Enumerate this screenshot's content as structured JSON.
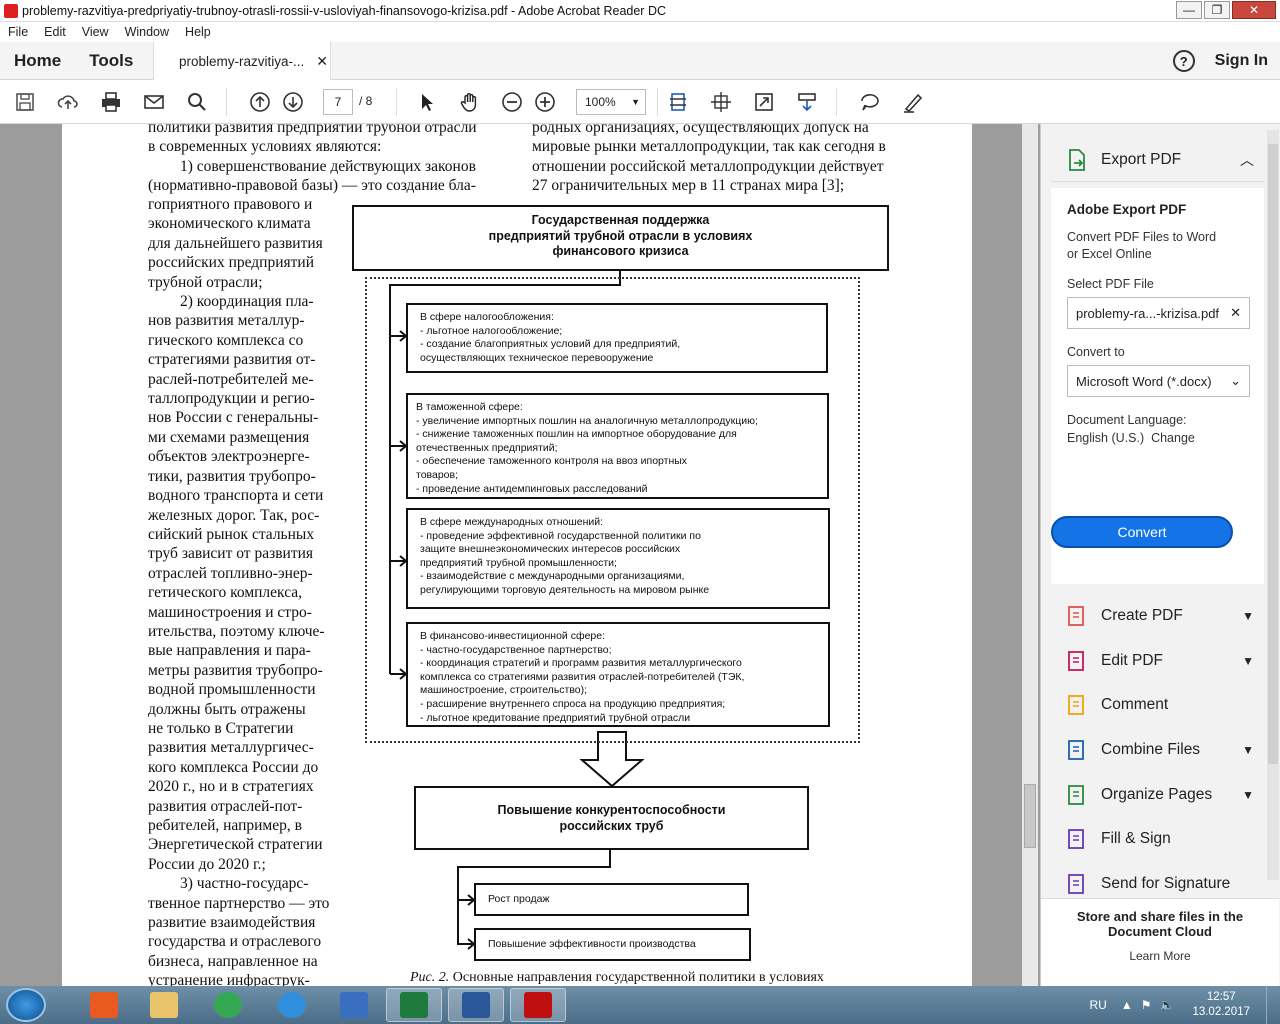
{
  "window": {
    "title": "problemy-razvitiya-predpriyatiy-trubnoy-otrasli-rossii-v-usloviyah-finansovogo-krizisa.pdf - Adobe Acrobat Reader DC"
  },
  "menu": [
    "File",
    "Edit",
    "View",
    "Window",
    "Help"
  ],
  "tabs": {
    "home": "Home",
    "tools": "Tools",
    "doc": "problemy-razvitiya-...",
    "signin": "Sign In"
  },
  "toolbar": {
    "page_current": "7",
    "page_total": "/ 8",
    "zoom": "100%"
  },
  "document": {
    "top_left": [
      "политики развития предприятий трубной отрасли",
      "в современных условиях являются:",
      "1) совершенствование действующих законов",
      "(нормативно-правовой базы) — это создание бла-"
    ],
    "top_right": [
      "родных организациях, осуществляющих допуск на",
      "мировые рынки металлопродукции, так как сегодня в",
      "отношении российской металлопродукции действует",
      "27 ограничительных мер в 11 странах мира [3];"
    ],
    "left_column": [
      "гоприятного правового и",
      "экономического климата",
      "для дальнейшего развития",
      "российских предприятий",
      "трубной отрасли;",
      "2) координация пла-",
      "нов развития металлур-",
      "гического комплекса со",
      "стратегиями развития от-",
      "раслей-потребителей ме-",
      "таллопродукции и регио-",
      "нов России с генеральны-",
      "ми схемами размещения",
      "объектов электроэнерге-",
      "тики, развития трубопро-",
      "водного транспорта и сети",
      "железных дорог. Так, рос-",
      "сийский рынок стальных",
      "труб зависит от развития",
      "отраслей топливно-энер-",
      "гетического комплекса,",
      "машиностроения и стро-",
      "ительства, поэтому ключе-",
      "вые направления и пара-",
      "метры развития трубопро-",
      "водной промышленности",
      "должны быть отражены",
      "не только в Стратегии",
      "развития металлургичес-",
      "кого комплекса России до",
      "2020 г., но и в стратегиях",
      "развития отраслей-пот-",
      "ребителей, например, в",
      "Энергетической стратегии",
      "России до 2020 г.;",
      "3) частно-государс-",
      "твенное партнерство — это",
      "развитие взаимодействия",
      "государства и отраслевого",
      "бизнеса, направленное на",
      "устранение инфраструк-"
    ],
    "diagram": {
      "title": [
        "Государственная поддержка",
        "предприятий трубной отрасли в условиях",
        "финансового кризиса"
      ],
      "box1": [
        "В сфере налогообложения:",
        "- льготное налогообложение;",
        "- создание благоприятных условий для предприятий,",
        "осуществляющих техническое перевооружение"
      ],
      "box2": [
        "В таможенной сфере:",
        "- увеличение импортных пошлин на аналогичную металлопродукцию;",
        "- снижение таможенных пошлин на импортное оборудование для",
        "отечественных предприятий;",
        "- обеспечение таможенного контроля на ввоз ипортных",
        "товаров;",
        "- проведение антидемпинговых расследований"
      ],
      "box3": [
        "В сфере международных отношений:",
        "- проведение эффективной государственной политики по",
        "защите внешнеэкономических интересов российских",
        "предприятий трубной промышленности;",
        "- взаимодействие с международными организациями,",
        "регулирующими торговую деятельность на мировом рынке"
      ],
      "box4": [
        "В финансово-инвестиционной сфере:",
        "- частно-государственное партнерство;",
        "- координация стратегий и программ развития металлургического",
        "комплекса со стратегиями развития отраслей-потребителей (ТЭК,",
        "машиностроение, строительство);",
        "- расширение внутреннего спроса на продукцию предприятия;",
        "- льготное кредитование предприятий трубной отрасли"
      ],
      "result": [
        "Повышение конкурентоспособности",
        "российских труб"
      ],
      "out1": "Рост продаж",
      "out2": "Повышение эффективности производства"
    },
    "caption_label": "Рис. 2.",
    "caption_text": " Основные направления государственной политики в условиях"
  },
  "panel": {
    "export_title": "Export PDF",
    "card_title": "Adobe Export PDF",
    "desc": [
      "Convert PDF Files to Word",
      "or Excel Online"
    ],
    "select_label": "Select PDF File",
    "file": "problemy-ra...-krizisa.pdf",
    "convert_to_label": "Convert to",
    "format": "Microsoft Word (*.docx)",
    "lang_label": "Document Language:",
    "lang_value": "English (U.S.)",
    "lang_change": "Change",
    "convert_btn": "Convert",
    "tools": [
      {
        "label": "Create PDF",
        "icon": "create-pdf-icon",
        "chev": true
      },
      {
        "label": "Edit PDF",
        "icon": "edit-pdf-icon",
        "chev": true
      },
      {
        "label": "Comment",
        "icon": "comment-icon",
        "chev": false
      },
      {
        "label": "Combine Files",
        "icon": "combine-files-icon",
        "chev": true
      },
      {
        "label": "Organize Pages",
        "icon": "organize-pages-icon",
        "chev": true
      },
      {
        "label": "Fill & Sign",
        "icon": "fill-sign-icon",
        "chev": false
      },
      {
        "label": "Send for Signature",
        "icon": "send-signature-icon",
        "chev": false
      }
    ],
    "cloud": [
      "Store and share files in the",
      "Document Cloud"
    ],
    "learn_more": "Learn More"
  },
  "taskbar": {
    "lang": "RU",
    "time": "12:57",
    "date": "13.02.2017"
  }
}
